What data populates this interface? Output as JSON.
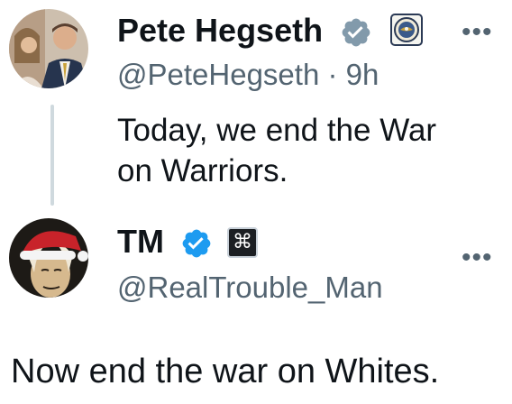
{
  "thread": {
    "original": {
      "name": "Pete Hegseth",
      "handle": "@PeteHegseth",
      "separator": "·",
      "time": "9h",
      "text_line1": "Today, we end the War",
      "text_line2": "on Warriors.",
      "verified_color": "#829aab",
      "affiliation_badge": "department-seal-icon"
    },
    "reply": {
      "name": "TM",
      "handle": "@RealTrouble_Man",
      "text": "Now end the war on Whites.",
      "verified_color": "#1d9bf0",
      "affiliation_badge": "command-key-icon",
      "affiliation_glyph": "⌘"
    }
  },
  "more_glyph": "•••",
  "colors": {
    "text": "#0f1419",
    "secondary": "#536471",
    "thread_line": "#cfd9de"
  }
}
